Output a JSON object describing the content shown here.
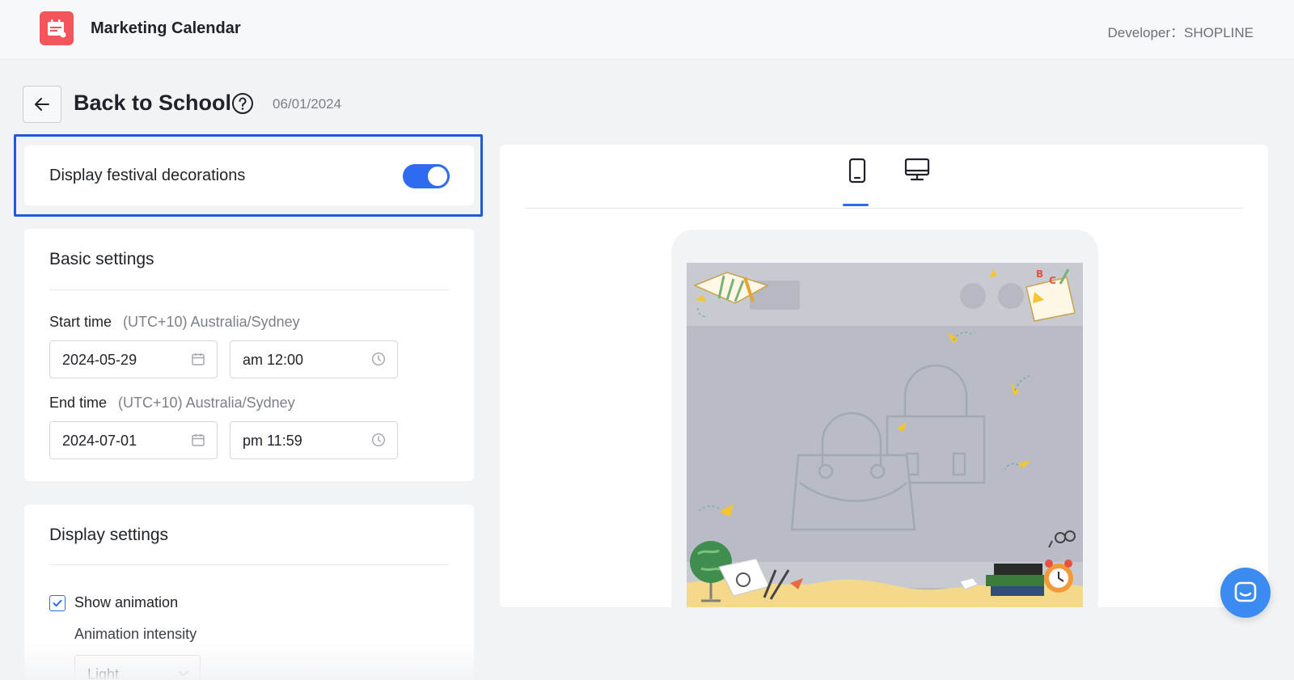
{
  "app": {
    "title": "Marketing Calendar",
    "developer": "Developer：SHOPLINE"
  },
  "page": {
    "title": "Back to School",
    "date": "06/01/2024"
  },
  "festival_toggle": {
    "label": "Display festival decorations",
    "enabled": true
  },
  "basic_settings": {
    "title": "Basic settings",
    "start": {
      "label": "Start time",
      "timezone": "(UTC+10) Australia/Sydney",
      "date": "2024-05-29",
      "time": "am 12:00"
    },
    "end": {
      "label": "End time",
      "timezone": "(UTC+10) Australia/Sydney",
      "date": "2024-07-01",
      "time": "pm 11:59"
    }
  },
  "display_settings": {
    "title": "Display settings",
    "show_animation": {
      "label": "Show animation",
      "checked": true
    },
    "intensity": {
      "label": "Animation intensity",
      "value": "Light"
    }
  },
  "preview": {
    "tabs": [
      {
        "icon": "mobile-icon",
        "active": true
      },
      {
        "icon": "desktop-icon",
        "active": false
      }
    ]
  },
  "colors": {
    "accent": "#2f6bf0",
    "highlight": "#1f5bd9",
    "logo": "#f2555a",
    "chat": "#3b8bf0"
  }
}
